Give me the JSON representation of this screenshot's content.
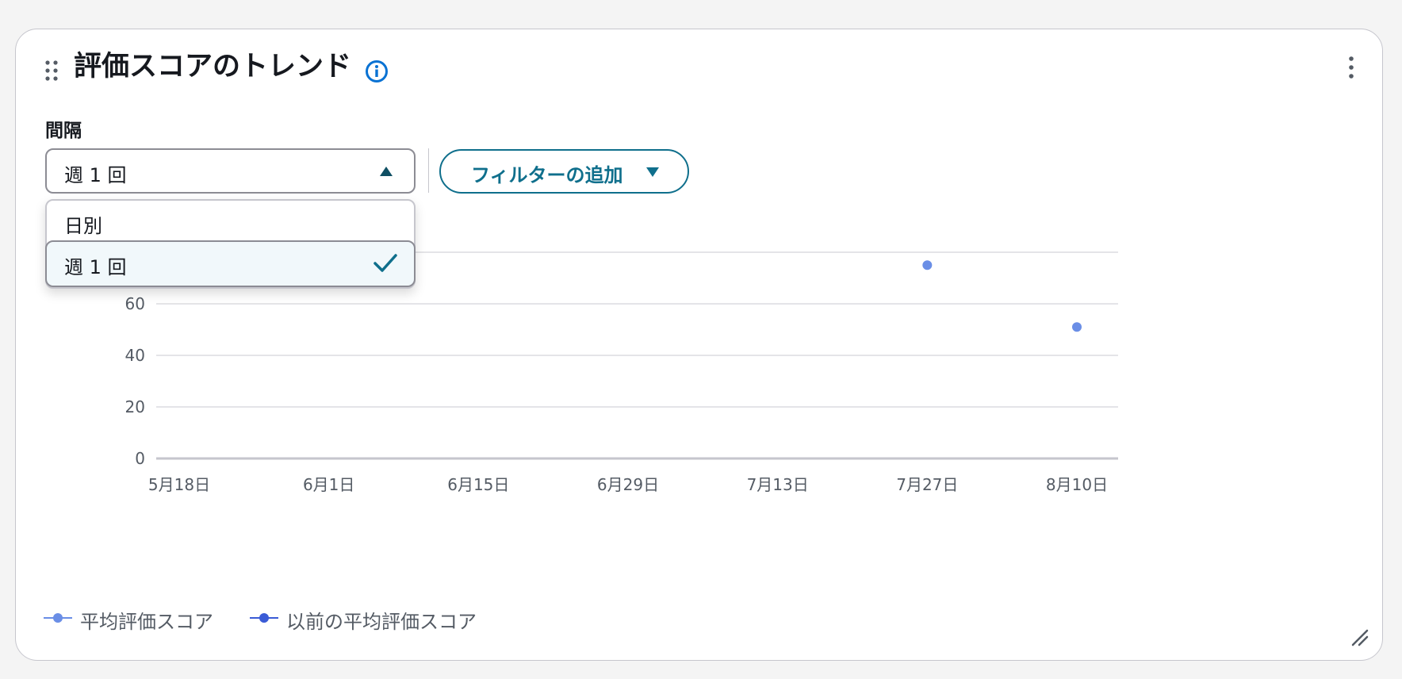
{
  "widget": {
    "title": "評価スコアのトレンド",
    "interval_label": "間隔",
    "selected_interval": "週 1 回",
    "filter_button_label": "フィルターの追加",
    "dropdown_options": [
      {
        "label": "日別",
        "selected": false
      },
      {
        "label": "週 1 回",
        "selected": true
      }
    ]
  },
  "colors": {
    "accent": "#0f6f8c",
    "series_current": "#6a8ee6",
    "series_previous": "#3a5bd6",
    "grid": "#dcdce0",
    "text": "#16191f",
    "muted": "#545b64"
  },
  "chart_data": {
    "type": "scatter",
    "title": "評価スコアのトレンド",
    "xlabel": "",
    "ylabel": "",
    "x_ticks": [
      "5月18日",
      "6月1日",
      "6月15日",
      "6月29日",
      "7月13日",
      "7月27日",
      "8月10日"
    ],
    "y_ticks": [
      0,
      20,
      40,
      60
    ],
    "ylim": [
      0,
      80
    ],
    "grid": true,
    "legend_position": "bottom-left",
    "series": [
      {
        "name": "平均評価スコア",
        "points": [
          {
            "x": "7月27日",
            "y": 75
          },
          {
            "x": "8月10日",
            "y": 51
          }
        ]
      },
      {
        "name": "以前の平均評価スコア",
        "points": []
      }
    ]
  }
}
